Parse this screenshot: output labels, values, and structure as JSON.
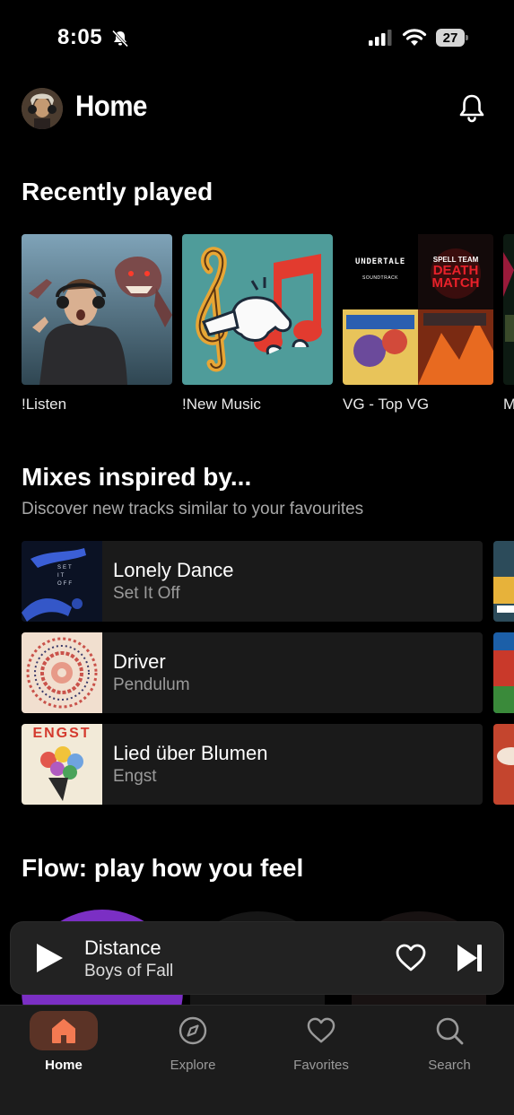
{
  "status_bar": {
    "time": "8:05",
    "battery": "27"
  },
  "header": {
    "title": "Home"
  },
  "recently_played": {
    "title": "Recently played",
    "items": [
      {
        "label": "!Listen"
      },
      {
        "label": "!New Music"
      },
      {
        "label": "VG - Top VG",
        "collage_texts": [
          "UNDERTALE",
          "SOUNDTRACK",
          "SPELL TEAM",
          "DEATH",
          "MATCH"
        ]
      },
      {
        "label": "M"
      }
    ]
  },
  "mixes": {
    "title": "Mixes inspired by...",
    "subtitle": "Discover new tracks similar to your favourites",
    "items": [
      {
        "title": "Lonely Dance",
        "artist": "Set It Off",
        "art_text": "SET IT OFF"
      },
      {
        "title": "Driver",
        "artist": "Pendulum"
      },
      {
        "title": "Lied über Blumen",
        "artist": "Engst",
        "art_text": "ENGST"
      }
    ]
  },
  "flow": {
    "title": "Flow: play how you feel"
  },
  "mini_player": {
    "title": "Distance",
    "artist": "Boys of Fall"
  },
  "nav": {
    "items": [
      {
        "label": "Home",
        "active": true
      },
      {
        "label": "Explore"
      },
      {
        "label": "Favorites"
      },
      {
        "label": "Search"
      }
    ]
  },
  "colors": {
    "accent": "#f47a52",
    "active_nav_bg": "#5b3326",
    "background": "#000000",
    "card": "#1a1a1a"
  }
}
